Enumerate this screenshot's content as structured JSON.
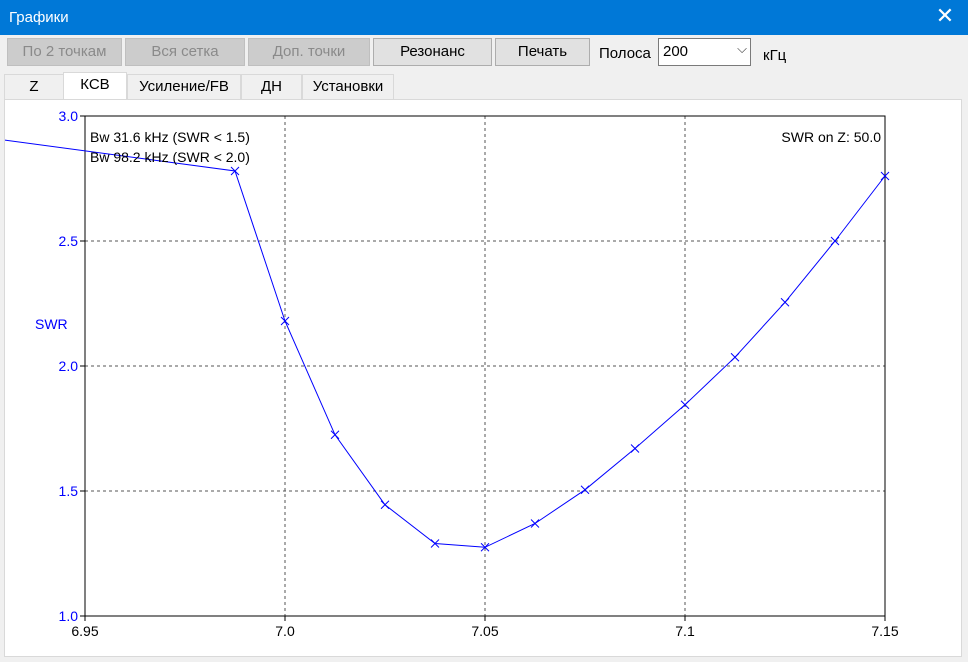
{
  "window": {
    "title": "Графики",
    "close_icon": "close-icon"
  },
  "toolbar": {
    "btn_two_points": "По 2 точкам",
    "btn_all_grid": "Вся сетка",
    "btn_extra_points": "Доп. точки",
    "btn_resonance": "Резонанс",
    "btn_print": "Печать",
    "band_label": "Полоса",
    "band_value": "200",
    "band_unit": "кГц"
  },
  "tabs": [
    {
      "label": "Z",
      "active": false
    },
    {
      "label": "КСВ",
      "active": true
    },
    {
      "label": "Усиление/FB",
      "active": false
    },
    {
      "label": "ДН",
      "active": false
    },
    {
      "label": "Установки",
      "active": false
    }
  ],
  "chart": {
    "bw_line1": "Bw 31.6 kHz (SWR < 1.5)",
    "bw_line2": "Bw 98.2 kHz (SWR < 2.0)",
    "swr_on_z": "SWR on Z: 50.0"
  },
  "chart_data": {
    "type": "line",
    "title": "",
    "xlabel": "",
    "ylabel": "SWR",
    "xlim": [
      6.95,
      7.15
    ],
    "ylim": [
      1.0,
      3.0
    ],
    "x_ticks": [
      "6.95",
      "7.0",
      "7.05",
      "7.1",
      "7.15"
    ],
    "y_ticks": [
      "1.0",
      "1.5",
      "2.0",
      "2.5",
      "3.0"
    ],
    "grid": true,
    "line_color": "#0000ff",
    "axis_label_color": "#0000ff",
    "series": [
      {
        "points": [
          [
            6.885,
            3.0
          ],
          [
            6.9875,
            2.78
          ],
          [
            7.0,
            2.18
          ],
          [
            7.0125,
            1.725
          ],
          [
            7.025,
            1.445
          ],
          [
            7.0375,
            1.29
          ],
          [
            7.05,
            1.275
          ],
          [
            7.0625,
            1.37
          ],
          [
            7.075,
            1.505
          ],
          [
            7.0875,
            1.67
          ],
          [
            7.1,
            1.845
          ],
          [
            7.1125,
            2.035
          ],
          [
            7.125,
            2.255
          ],
          [
            7.1375,
            2.5
          ],
          [
            7.15,
            2.76
          ]
        ],
        "markers": [
          [
            6.9875,
            2.78
          ],
          [
            7.0,
            2.18
          ],
          [
            7.0125,
            1.725
          ],
          [
            7.025,
            1.445
          ],
          [
            7.0375,
            1.29
          ],
          [
            7.05,
            1.275
          ],
          [
            7.0625,
            1.37
          ],
          [
            7.075,
            1.505
          ],
          [
            7.0875,
            1.67
          ],
          [
            7.1,
            1.845
          ],
          [
            7.1125,
            2.035
          ],
          [
            7.125,
            2.255
          ],
          [
            7.1375,
            2.5
          ],
          [
            7.15,
            2.76
          ]
        ]
      }
    ]
  }
}
